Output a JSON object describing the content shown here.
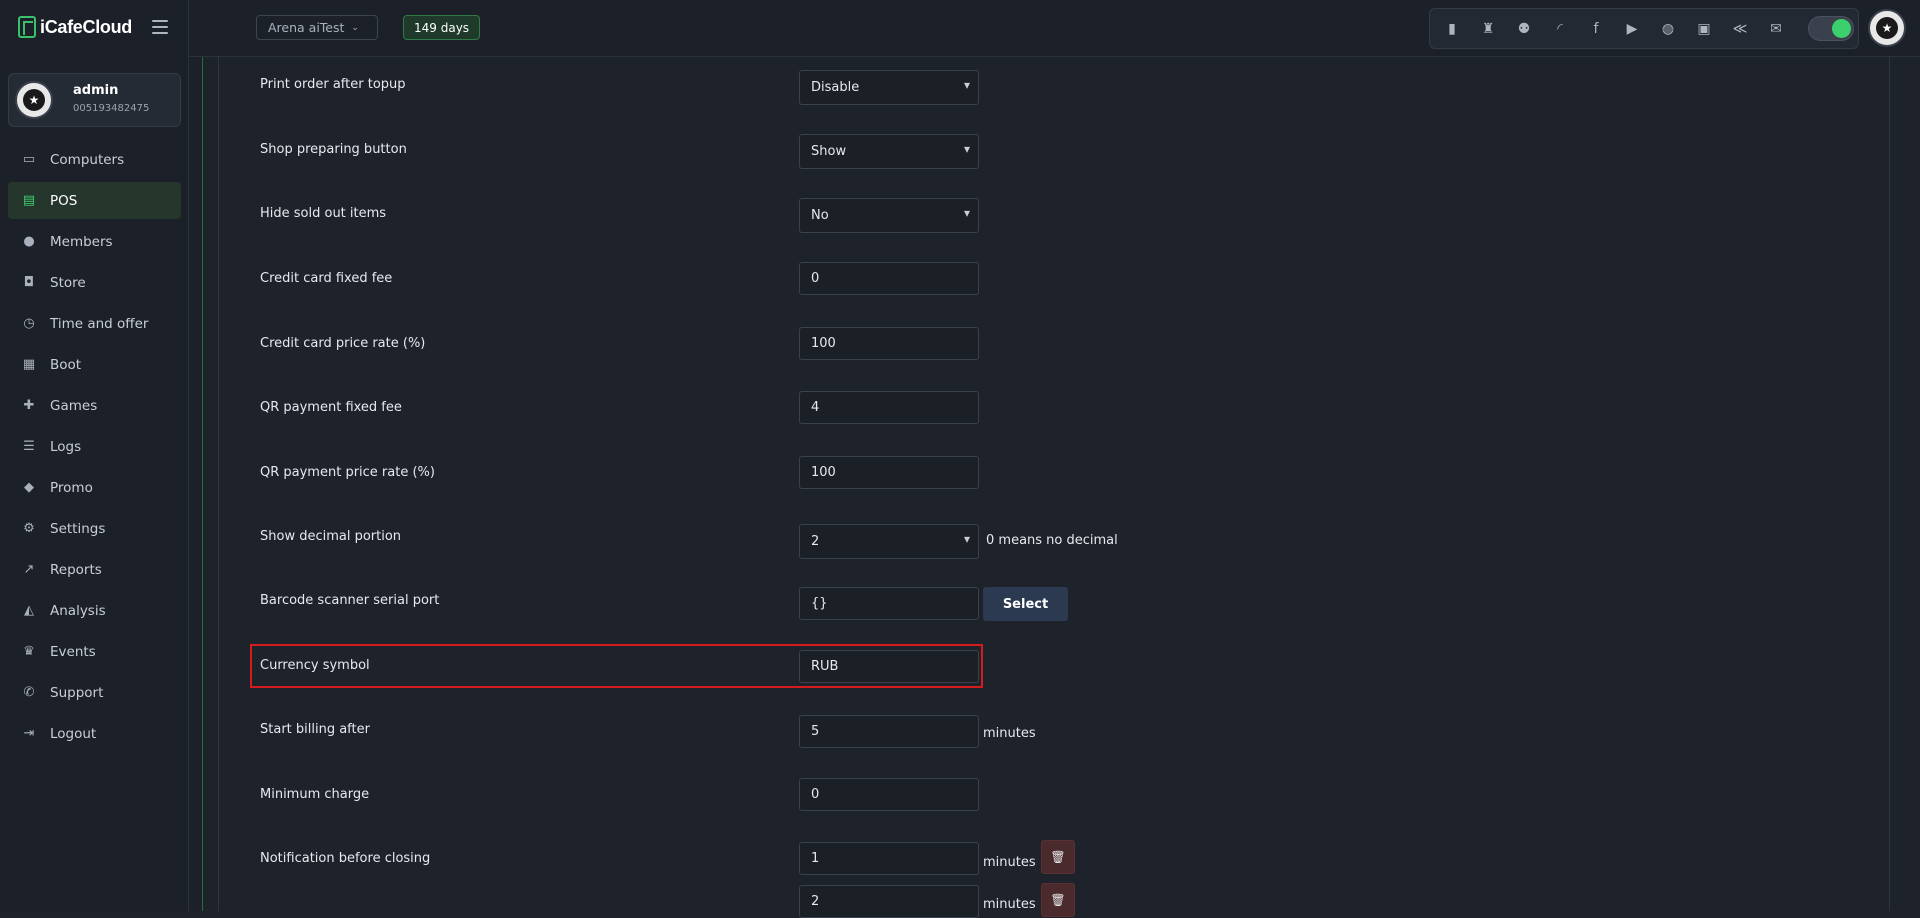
{
  "app": {
    "logo_text": "iCafeCloud"
  },
  "user": {
    "name": "admin",
    "id": "005193482475"
  },
  "nav": [
    {
      "label": "Computers",
      "icon": "monitor-icon",
      "active": false
    },
    {
      "label": "POS",
      "icon": "pos-icon",
      "active": true
    },
    {
      "label": "Members",
      "icon": "members-icon",
      "active": false
    },
    {
      "label": "Store",
      "icon": "store-icon",
      "active": false
    },
    {
      "label": "Time and offer",
      "icon": "timer-icon",
      "active": false
    },
    {
      "label": "Boot",
      "icon": "windows-icon",
      "active": false
    },
    {
      "label": "Games",
      "icon": "gamepad-icon",
      "active": false
    },
    {
      "label": "Logs",
      "icon": "list-icon",
      "active": false
    },
    {
      "label": "Promo",
      "icon": "tag-icon",
      "active": false
    },
    {
      "label": "Settings",
      "icon": "gear-icon",
      "active": false
    },
    {
      "label": "Reports",
      "icon": "chart-line-icon",
      "active": false
    },
    {
      "label": "Analysis",
      "icon": "analysis-icon",
      "active": false
    },
    {
      "label": "Events",
      "icon": "crown-icon",
      "active": false
    },
    {
      "label": "Support",
      "icon": "phone-icon",
      "active": false
    },
    {
      "label": "Logout",
      "icon": "logout-icon",
      "active": false
    }
  ],
  "header": {
    "shop_name": "Arena aiTest",
    "days_badge": "149 days",
    "tray_icons": [
      "leaderboard-icon",
      "trophy-icon",
      "group-icon",
      "rss-icon",
      "facebook-icon",
      "youtube-icon",
      "globe-icon",
      "icafe-icon",
      "handshake-icon",
      "mail-icon"
    ]
  },
  "settings": {
    "print_order": {
      "label": "Print order after topup",
      "value": "Disable"
    },
    "shop_preparing": {
      "label": "Shop preparing button",
      "value": "Show"
    },
    "hide_sold_out": {
      "label": "Hide sold out items",
      "value": "No"
    },
    "cc_fixed_fee": {
      "label": "Credit card fixed fee",
      "value": "0"
    },
    "cc_price_rate": {
      "label": "Credit card price rate (%)",
      "value": "100"
    },
    "qr_fixed_fee": {
      "label": "QR payment fixed fee",
      "value": "4"
    },
    "qr_price_rate": {
      "label": "QR payment price rate (%)",
      "value": "100"
    },
    "decimal": {
      "label": "Show decimal portion",
      "value": "2",
      "hint": "0 means no decimal"
    },
    "barcode": {
      "label": "Barcode scanner serial port",
      "value": "{}",
      "button": "Select"
    },
    "currency": {
      "label": "Currency symbol",
      "value": "RUB"
    },
    "start_billing": {
      "label": "Start billing after",
      "value": "5",
      "unit": "minutes"
    },
    "min_charge": {
      "label": "Minimum charge",
      "value": "0"
    },
    "notification": {
      "label": "Notification before closing",
      "values": [
        "1",
        "2"
      ],
      "unit": "minutes"
    }
  }
}
